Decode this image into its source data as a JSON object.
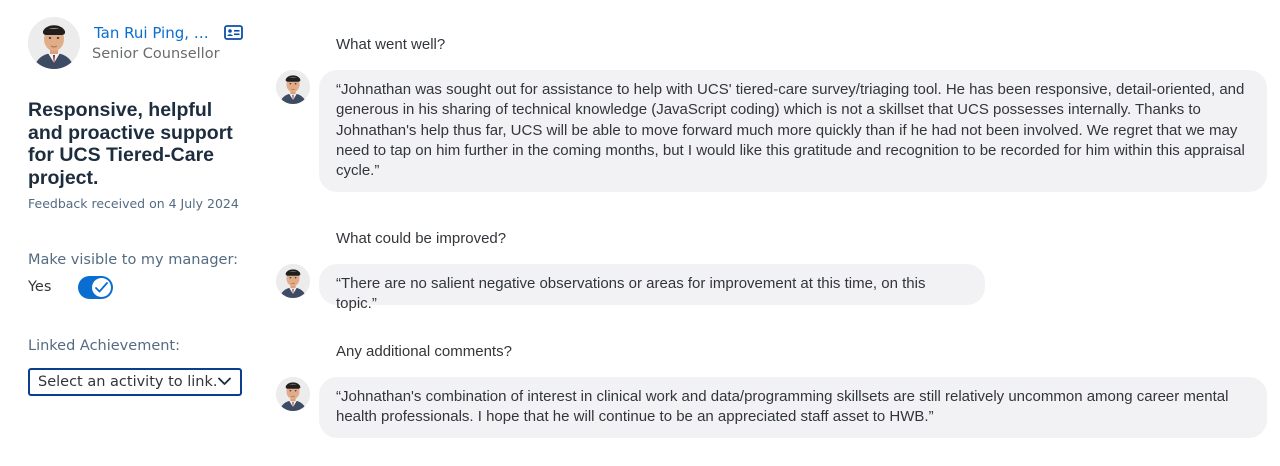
{
  "author": {
    "name": "Tan Rui Ping, Be...",
    "role": "Senior Counsellor",
    "card_icon": "contact-card-icon"
  },
  "feedback": {
    "title": "Responsive, helpful and proactive support for UCS Tiered-Care project.",
    "date_text": "Feedback received on 4 July 2024"
  },
  "visibility": {
    "label": "Make visible to my manager:",
    "value": "Yes",
    "toggle_on": true
  },
  "linked": {
    "label": "Linked Achievement:",
    "select_value": "Select an activity to link."
  },
  "sections": [
    {
      "question": "What went well?",
      "answer": "“Johnathan was sought out for assistance to help with UCS' tiered-care survey/triaging tool. He has been responsive, detail-oriented, and generous in his sharing of technical knowledge (JavaScript coding) which is not a skillset that UCS possesses internally. Thanks to Johnathan's help thus far, UCS will be able to move forward much more quickly than if he had not been involved. We regret that we may need to tap on him further in the coming months, but I would like this gratitude and recognition to be recorded for him within this appraisal cycle.”"
    },
    {
      "question": "What could be improved?",
      "answer": "“There are no salient negative observations or areas for improvement at this time, on this topic.”"
    },
    {
      "question": "Any additional comments?",
      "answer": "“Johnathan's combination of interest in clinical work and data/programming skillsets are still relatively uncommon among career mental health professionals. I hope that he will continue to be an appreciated staff asset to HWB.”"
    }
  ],
  "colors": {
    "accent": "#0a6ed1",
    "title": "#1d2d3e",
    "bubble": "#f2f2f4"
  }
}
